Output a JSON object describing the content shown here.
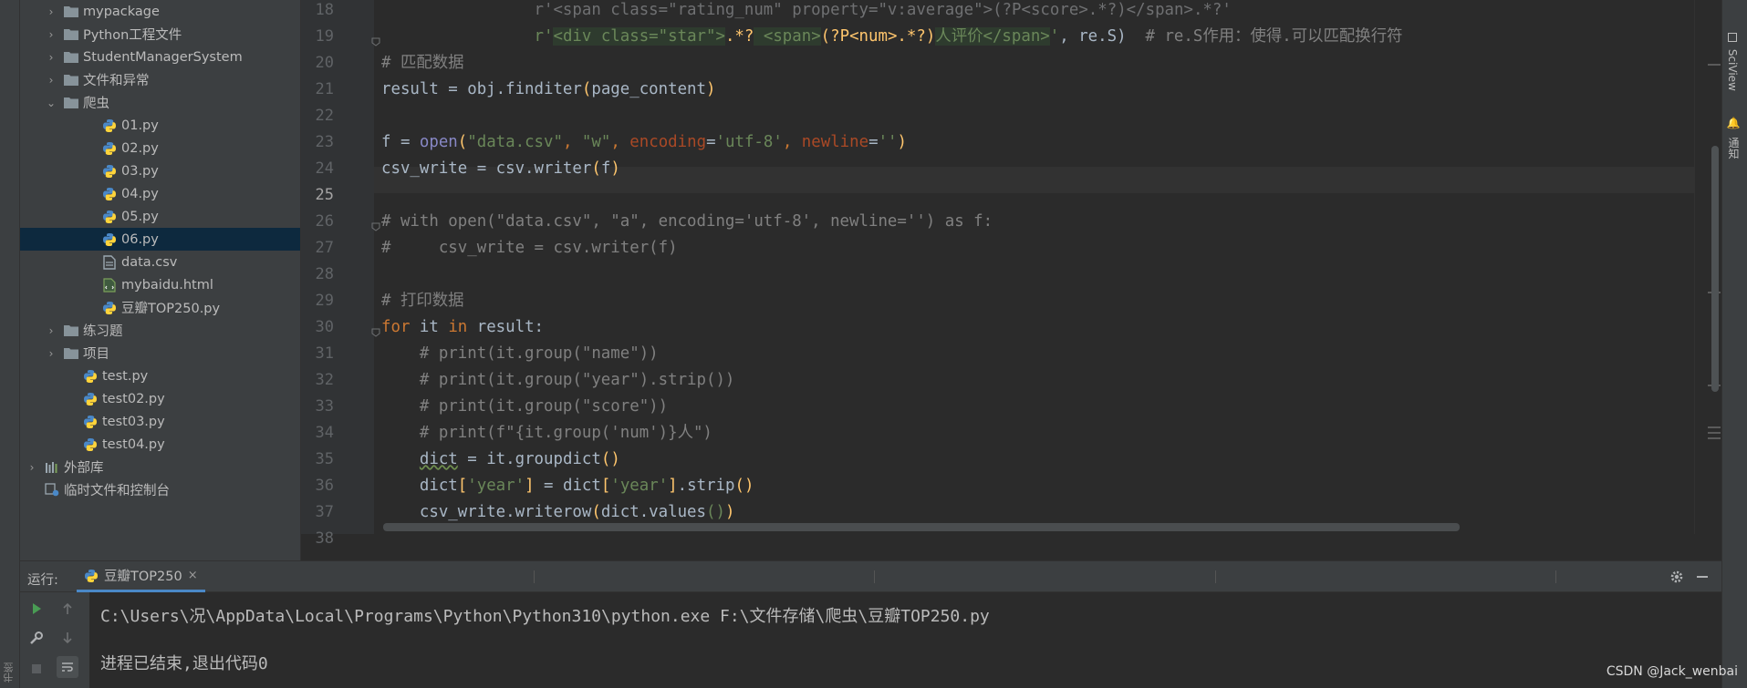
{
  "left_strip": {
    "bookmark_label": "书签"
  },
  "project_tree": [
    {
      "label": "mypackage",
      "type": "folder",
      "arrow": "›",
      "indent": 1
    },
    {
      "label": "Python工程文件",
      "type": "folder",
      "arrow": "›",
      "indent": 1
    },
    {
      "label": "StudentManagerSystem",
      "type": "folder",
      "arrow": "›",
      "indent": 1
    },
    {
      "label": "文件和异常",
      "type": "folder",
      "arrow": "›",
      "indent": 1
    },
    {
      "label": "爬虫",
      "type": "folder",
      "arrow": "⌄",
      "indent": 1
    },
    {
      "label": "01.py",
      "type": "py",
      "arrow": "",
      "indent": 3
    },
    {
      "label": "02.py",
      "type": "py",
      "arrow": "",
      "indent": 3
    },
    {
      "label": "03.py",
      "type": "py",
      "arrow": "",
      "indent": 3
    },
    {
      "label": "04.py",
      "type": "py",
      "arrow": "",
      "indent": 3
    },
    {
      "label": "05.py",
      "type": "py",
      "arrow": "",
      "indent": 3
    },
    {
      "label": "06.py",
      "type": "py",
      "arrow": "",
      "indent": 3,
      "selected": true
    },
    {
      "label": "data.csv",
      "type": "csv",
      "arrow": "",
      "indent": 3
    },
    {
      "label": "mybaidu.html",
      "type": "html",
      "arrow": "",
      "indent": 3
    },
    {
      "label": "豆瓣TOP250.py",
      "type": "py",
      "arrow": "",
      "indent": 3
    },
    {
      "label": "练习题",
      "type": "folder",
      "arrow": "›",
      "indent": 1
    },
    {
      "label": "项目",
      "type": "folder",
      "arrow": "›",
      "indent": 1
    },
    {
      "label": "test.py",
      "type": "py",
      "arrow": "",
      "indent": 2
    },
    {
      "label": "test02.py",
      "type": "py",
      "arrow": "",
      "indent": 2
    },
    {
      "label": "test03.py",
      "type": "py",
      "arrow": "",
      "indent": 2
    },
    {
      "label": "test04.py",
      "type": "py",
      "arrow": "",
      "indent": 2
    },
    {
      "label": "外部库",
      "type": "lib",
      "arrow": "›",
      "indent": 0
    },
    {
      "label": "临时文件和控制台",
      "type": "scratch",
      "arrow": "",
      "indent": 0
    }
  ],
  "editor": {
    "current_line": "25",
    "line_numbers": [
      "18",
      "19",
      "20",
      "21",
      "22",
      "23",
      "24",
      "25",
      "26",
      "27",
      "28",
      "29",
      "30",
      "31",
      "32",
      "33",
      "34",
      "35",
      "36",
      "37",
      "38"
    ],
    "lines": [
      [
        [
          "dim",
          "                r'<span class=\"rating_num\" property=\"v:average\">(?P<score>.*?)</span>.*?'"
        ]
      ],
      [
        [
          "",
          "                "
        ],
        [
          "st",
          "r'"
        ],
        [
          "st regex-bg",
          "<div class=\"star\">"
        ],
        [
          "br",
          ".*?"
        ],
        [
          "st regex-bg",
          " <span>"
        ],
        [
          "br",
          "(?P<num>.*?)"
        ],
        [
          "st regex-bg",
          "人评价</span>"
        ],
        [
          "st",
          "'"
        ],
        [
          "",
          ", re.S)  "
        ],
        [
          "cm",
          "# re.S作用：使得.可以匹配换行符"
        ]
      ],
      [
        [
          "cm",
          "# 匹配数据"
        ]
      ],
      [
        [
          "",
          "result = obj.finditer"
        ],
        [
          "br",
          "("
        ],
        [
          "",
          "page_content"
        ],
        [
          "br",
          ")"
        ]
      ],
      [
        [
          "",
          ""
        ]
      ],
      [
        [
          "",
          "f = "
        ],
        [
          "fn",
          "open"
        ],
        [
          "br",
          "("
        ],
        [
          "st",
          "\"data.csv\""
        ],
        [
          "kw",
          ", "
        ],
        [
          "st",
          "\"w\""
        ],
        [
          "kw",
          ", "
        ],
        [
          "pr",
          "encoding"
        ],
        [
          "",
          "="
        ],
        [
          "st",
          "'utf-8'"
        ],
        [
          "kw",
          ", "
        ],
        [
          "pr",
          "newline"
        ],
        [
          "",
          "="
        ],
        [
          "st",
          "''"
        ],
        [
          "br",
          ")"
        ]
      ],
      [
        [
          "",
          "csv_write = csv.writer"
        ],
        [
          "br",
          "("
        ],
        [
          "",
          "f"
        ],
        [
          "br",
          ")"
        ]
      ],
      [
        [
          "",
          ""
        ]
      ],
      [
        [
          "cm",
          "# with open(\"data.csv\", \"a\", encoding='utf-8', newline='') as f:"
        ]
      ],
      [
        [
          "cm",
          "#     csv_write = csv.writer(f)"
        ]
      ],
      [
        [
          "",
          ""
        ]
      ],
      [
        [
          "cm",
          "# 打印数据"
        ]
      ],
      [
        [
          "kw",
          "for "
        ],
        [
          "",
          "it "
        ],
        [
          "kw",
          "in "
        ],
        [
          "",
          "result:"
        ]
      ],
      [
        [
          "cm",
          "    # print(it.group(\"name\"))"
        ]
      ],
      [
        [
          "cm",
          "    # print(it.group(\"year\").strip())"
        ]
      ],
      [
        [
          "cm",
          "    # print(it.group(\"score\"))"
        ]
      ],
      [
        [
          "cm",
          "    # print(f\"{it.group('num')}人\")"
        ]
      ],
      [
        [
          "",
          "    "
        ],
        [
          "wavy",
          "dict"
        ],
        [
          "",
          " = it.groupdict"
        ],
        [
          "br",
          "()"
        ]
      ],
      [
        [
          "",
          "    dict"
        ],
        [
          "br",
          "["
        ],
        [
          "st",
          "'year'"
        ],
        [
          "br",
          "]"
        ],
        [
          "",
          " = dict"
        ],
        [
          "br",
          "["
        ],
        [
          "st",
          "'year'"
        ],
        [
          "br",
          "]"
        ],
        [
          "",
          ".strip"
        ],
        [
          "br",
          "()"
        ]
      ],
      [
        [
          "",
          "    csv_write.writerow"
        ],
        [
          "br",
          "("
        ],
        [
          "",
          "dict.values"
        ],
        [
          "st",
          "()"
        ],
        [
          "br",
          ")"
        ]
      ],
      [
        [
          "",
          ""
        ]
      ]
    ]
  },
  "right_strip": {
    "sciview": "SciView",
    "notifications": "通知"
  },
  "run_panel": {
    "label": "运行:",
    "tab_label": "豆瓣TOP250",
    "tab_close": "×",
    "console": [
      "C:\\Users\\况\\AppData\\Local\\Programs\\Python\\Python310\\python.exe F:\\文件存储\\爬虫\\豆瓣TOP250.py",
      "",
      "进程已结束,退出代码0"
    ]
  },
  "watermark": "CSDN @Jack_wenbai"
}
